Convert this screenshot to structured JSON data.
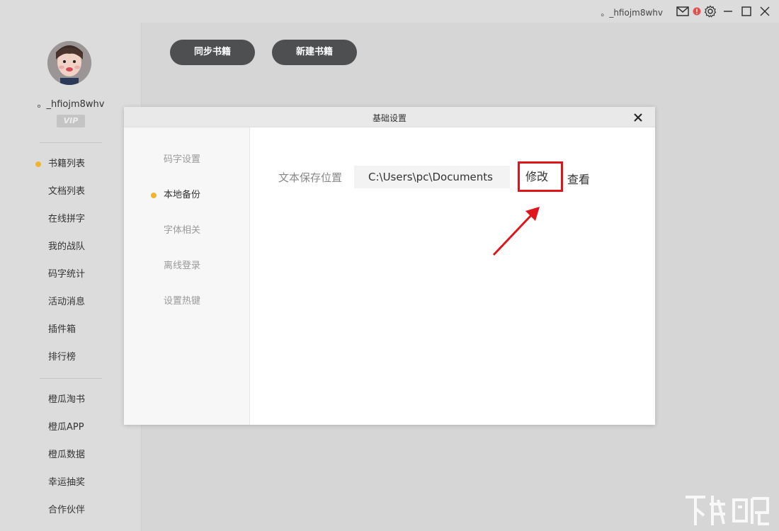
{
  "titlebar": {
    "username": "。_hfiojm8whv",
    "icons": [
      "mail-icon",
      "notification-badge-icon",
      "gear-icon",
      "minimize-icon",
      "maximize-icon",
      "close-icon"
    ],
    "accent_alert": "#e45050"
  },
  "sidebar": {
    "username": "。_hfiojm8whv",
    "vip_label": "VIP",
    "group1": [
      {
        "label": "书籍列表",
        "active": true
      },
      {
        "label": "文档列表"
      },
      {
        "label": "在线拼字"
      },
      {
        "label": "我的战队"
      },
      {
        "label": "码字统计"
      },
      {
        "label": "活动消息"
      },
      {
        "label": "插件箱"
      },
      {
        "label": "排行榜"
      }
    ],
    "group2": [
      {
        "label": "橙瓜淘书"
      },
      {
        "label": "橙瓜APP"
      },
      {
        "label": "橙瓜数据"
      },
      {
        "label": "幸运抽奖"
      },
      {
        "label": "合作伙伴"
      }
    ]
  },
  "toolbar": {
    "sync_label": "同步书籍",
    "new_label": "新建书籍"
  },
  "dialog": {
    "title": "基础设置",
    "tabs": [
      {
        "label": "码字设置"
      },
      {
        "label": "本地备份",
        "active": true
      },
      {
        "label": "字体相关"
      },
      {
        "label": "离线登录"
      },
      {
        "label": "设置热键"
      }
    ],
    "location_label": "文本保存位置",
    "location_path": "C:\\Users\\pc\\Documents",
    "modify_label": "修改",
    "view_label": "查看"
  },
  "colors": {
    "accent_dot": "#f0b431",
    "pill_bg": "#4d4f51",
    "highlight_red": "#e0141b"
  }
}
